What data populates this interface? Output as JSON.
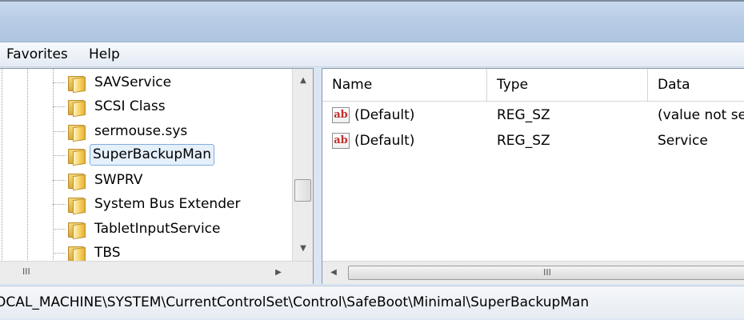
{
  "menu": {
    "items": [
      "Favorites",
      "Help"
    ]
  },
  "tree": {
    "items": [
      {
        "label": "SAVService",
        "selected": false
      },
      {
        "label": "SCSI Class",
        "selected": false
      },
      {
        "label": "sermouse.sys",
        "selected": false
      },
      {
        "label": "SuperBackupMan",
        "selected": true
      },
      {
        "label": "SWPRV",
        "selected": false
      },
      {
        "label": "System Bus Extender",
        "selected": false
      },
      {
        "label": "TabletInputService",
        "selected": false
      },
      {
        "label": "TBS",
        "selected": false
      }
    ],
    "hscroll_grip": "III"
  },
  "list": {
    "columns": [
      "Name",
      "Type",
      "Data"
    ],
    "rows": [
      {
        "icon": "ab",
        "name": "(Default)",
        "type": "REG_SZ",
        "data": "(value not se"
      },
      {
        "icon": "ab",
        "name": "(Default)",
        "type": "REG_SZ",
        "data": "Service"
      }
    ],
    "hscroll_grip": "III"
  },
  "status": {
    "path": "OCAL_MACHINE\\SYSTEM\\CurrentControlSet\\Control\\SafeBoot\\Minimal\\SuperBackupMan"
  },
  "colors": {
    "title_bar": "#b9cde6",
    "selection_border": "#84acdd",
    "selection_fill": "#e5f0fb",
    "string_icon_red": "#c0302a"
  },
  "icons": {
    "tree_node": "folder-icon",
    "string_value": "reg-string-value-icon",
    "scroll_up": "arrow-up-icon",
    "scroll_down": "arrow-down-icon",
    "scroll_left": "arrow-left-icon",
    "scroll_right": "arrow-right-icon"
  }
}
